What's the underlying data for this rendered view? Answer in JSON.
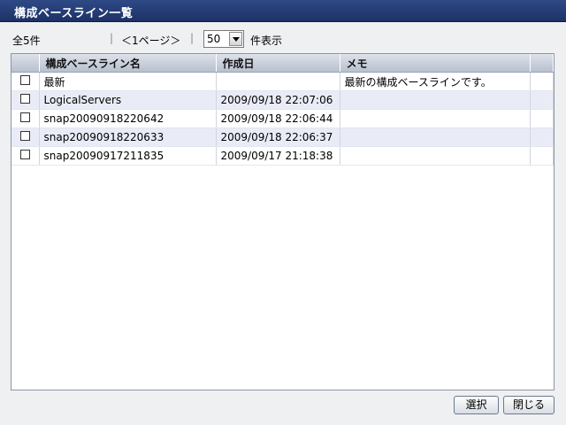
{
  "window": {
    "title": "構成ベースライン一覧"
  },
  "toolbar": {
    "total_count": "全5件",
    "separator": "|",
    "page_indicator": "＜1ページ＞",
    "per_page_value": "50",
    "per_page_suffix": "件表示"
  },
  "table": {
    "columns": [
      "",
      "構成ベースライン名",
      "作成日",
      "メモ"
    ],
    "rows": [
      {
        "name": "最新",
        "created": "",
        "memo": "最新の構成ベースラインです。"
      },
      {
        "name": "LogicalServers",
        "created": "2009/09/18 22:07:06",
        "memo": ""
      },
      {
        "name": "snap20090918220642",
        "created": "2009/09/18 22:06:44",
        "memo": ""
      },
      {
        "name": "snap20090918220633",
        "created": "2009/09/18 22:06:37",
        "memo": ""
      },
      {
        "name": "snap20090917211835",
        "created": "2009/09/17 21:18:38",
        "memo": ""
      }
    ]
  },
  "buttons": {
    "select_label": "選択",
    "close_label": "閉じる"
  },
  "colors": {
    "titlebar": "#1d3266",
    "header": "#c3cad6",
    "row_alt": "#e9ecf6"
  }
}
